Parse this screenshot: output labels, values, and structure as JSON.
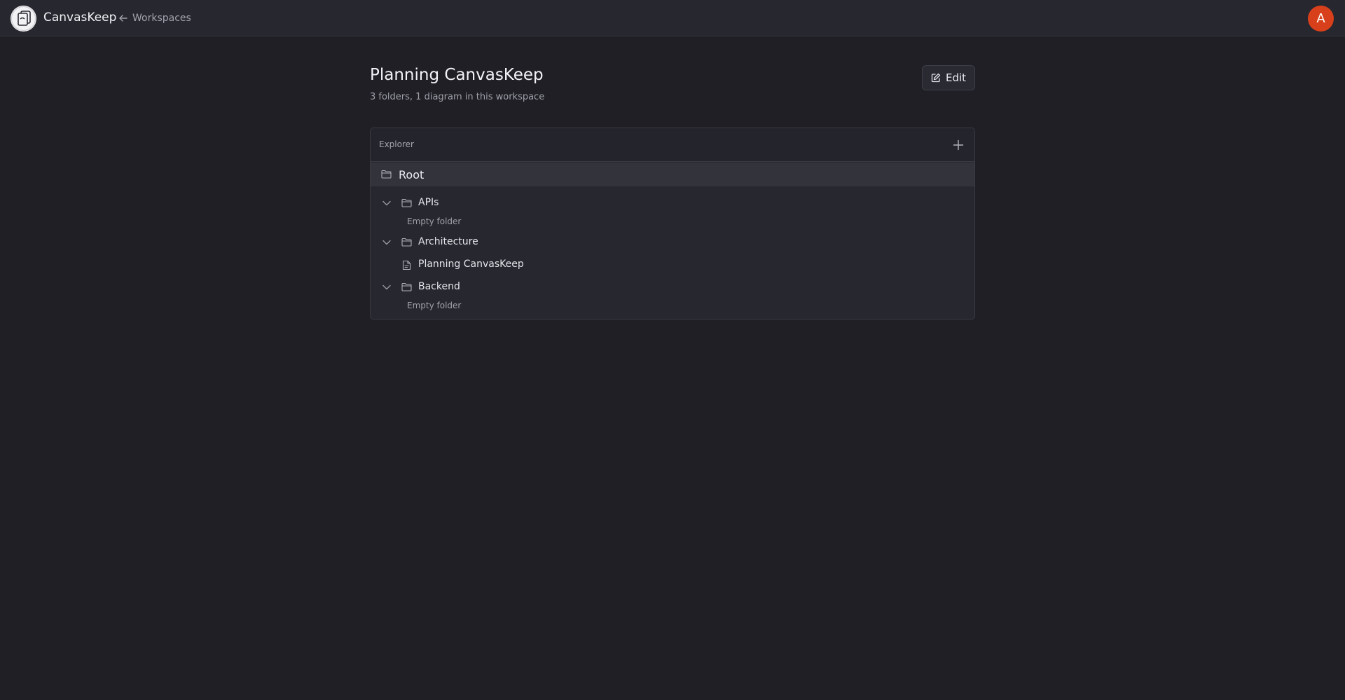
{
  "app": {
    "brand": "CanvasKeep",
    "back_link": "Workspaces",
    "avatar_initial": "A",
    "avatar_color": "#d8401b"
  },
  "page": {
    "title": "Planning CanvasKeep",
    "subtitle": "3 folders, 1 diagram in this workspace",
    "edit_label": "Edit"
  },
  "explorer": {
    "label": "Explorer",
    "root_label": "Root",
    "folders": [
      {
        "name": "APIs",
        "expanded": true,
        "empty_text": "Empty folder"
      },
      {
        "name": "Architecture",
        "expanded": true,
        "diagrams": [
          "Planning CanvasKeep"
        ]
      },
      {
        "name": "Backend",
        "expanded": true,
        "empty_text": "Empty folder"
      }
    ]
  },
  "icons": {
    "logo": "canvaskeep-logo-icon",
    "back": "arrow-left-icon",
    "edit": "pencil-square-icon",
    "add": "plus-icon",
    "folder": "folder-icon",
    "chevron": "chevron-down-icon",
    "diagram": "file-diagram-icon"
  }
}
